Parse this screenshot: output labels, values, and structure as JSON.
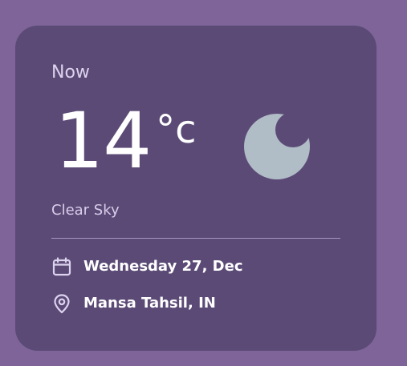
{
  "current": {
    "heading": "Now",
    "temperature": "14",
    "unit": "°c",
    "condition": "Clear Sky",
    "condition_icon": "moon-icon"
  },
  "details": {
    "date": "Wednesday 27, Dec",
    "location": "Mansa Tahsil, IN",
    "date_icon": "calendar-icon",
    "location_icon": "location-pin-icon"
  },
  "colors": {
    "page_background": "#7e6499",
    "card_background": "#5b4a76",
    "moon": "#b0bcc6",
    "text_primary": "#ffffff",
    "text_secondary": "#d8cdea"
  }
}
